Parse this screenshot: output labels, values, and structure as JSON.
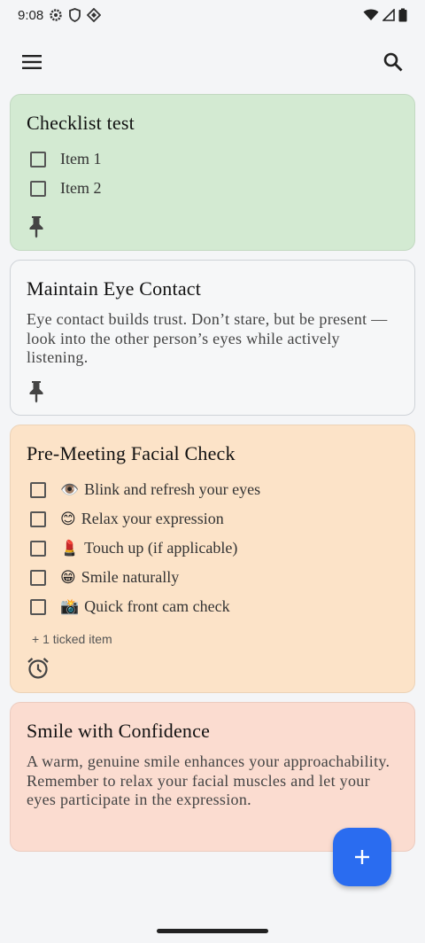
{
  "status": {
    "time": "9:08"
  },
  "icons": {
    "menu": "menu-icon",
    "search": "search-icon",
    "pin": "pin-icon",
    "alarm": "alarm-icon",
    "add": "plus-icon"
  },
  "colors": {
    "green_card": "#d3ead2",
    "white_card": "#f6f7f8",
    "orange_card": "#fce3c8",
    "peach_card": "#fbdcd0",
    "fab": "#2a6cf0"
  },
  "notes": [
    {
      "title": "Checklist test",
      "items": [
        "Item 1",
        "Item 2"
      ]
    },
    {
      "title": "Maintain Eye Contact",
      "body": "Eye contact builds trust. Don’t stare, but be present — look into the other person’s eyes while actively listening."
    },
    {
      "title": "Pre-Meeting Facial Check",
      "items": [
        {
          "emoji": "👁️",
          "text": "Blink and refresh your eyes"
        },
        {
          "emoji": "😊",
          "text": "Relax your expression"
        },
        {
          "emoji": "💄",
          "text": "Touch up (if applicable)"
        },
        {
          "emoji": "😁",
          "text": "Smile naturally"
        },
        {
          "emoji": "📸",
          "text": "Quick front cam check"
        }
      ],
      "ticked": "+ 1 ticked item"
    },
    {
      "title": "Smile with Confidence",
      "body": "A warm, genuine smile enhances your approachability. Remember to relax your facial muscles and let your eyes participate in the expression."
    }
  ]
}
